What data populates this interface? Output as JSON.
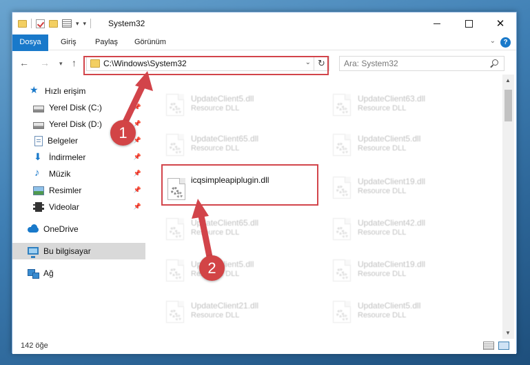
{
  "window": {
    "title": "System32",
    "controls": {
      "minimize": "",
      "maximize": "",
      "close": "✕"
    }
  },
  "ribbon": {
    "tabs": [
      "Dosya",
      "Giriş",
      "Paylaş",
      "Görünüm"
    ],
    "help": "?"
  },
  "address": {
    "path": "C:\\Windows\\System32",
    "search_placeholder": "Ara: System32"
  },
  "sidebar": {
    "items": [
      {
        "label": "Hızlı erişim",
        "icon": "star-icon"
      },
      {
        "label": "Yerel Disk (C:)",
        "icon": "disk-icon",
        "pinned": true
      },
      {
        "label": "Yerel Disk (D:)",
        "icon": "disk-icon",
        "pinned": true
      },
      {
        "label": "Belgeler",
        "icon": "documents-icon",
        "pinned": true
      },
      {
        "label": "İndirmeler",
        "icon": "download-icon",
        "pinned": true
      },
      {
        "label": "Müzik",
        "icon": "music-icon",
        "pinned": true
      },
      {
        "label": "Resimler",
        "icon": "pictures-icon",
        "pinned": true
      },
      {
        "label": "Videolar",
        "icon": "videos-icon",
        "pinned": true
      },
      {
        "label": "OneDrive",
        "icon": "onedrive-icon"
      },
      {
        "label": "Bu bilgisayar",
        "icon": "computer-icon",
        "selected": true
      },
      {
        "label": "Ağ",
        "icon": "network-icon"
      }
    ]
  },
  "files": {
    "left": [
      {
        "name": "UpdateClient5.dll",
        "type": "Resource DLL"
      },
      {
        "name": "UpdateClient65.dll",
        "type": "Resource DLL"
      },
      {
        "name": "icqsimpleapiplugin.dll",
        "type": ""
      },
      {
        "name": "UpdateClient65.dll",
        "type": "Resource DLL"
      },
      {
        "name": "UpdateClient5.dll",
        "type": "Resource DLL"
      },
      {
        "name": "UpdateClient21.dll",
        "type": "Resource DLL"
      }
    ],
    "right": [
      {
        "name": "UpdateClient63.dll",
        "type": "Resource DLL"
      },
      {
        "name": "UpdateClient5.dll",
        "type": "Resource DLL"
      },
      {
        "name": "UpdateClient19.dll",
        "type": "Resource DLL"
      },
      {
        "name": "UpdateClient42.dll",
        "type": "Resource DLL"
      },
      {
        "name": "UpdateClient19.dll",
        "type": "Resource DLL"
      },
      {
        "name": "UpdateClient5.dll",
        "type": "Resource DLL"
      }
    ]
  },
  "status": {
    "count": "142 öğe"
  },
  "annotations": {
    "step1": "1",
    "step2": "2"
  },
  "colors": {
    "accent": "#1979ca",
    "highlight": "#d2444a"
  }
}
